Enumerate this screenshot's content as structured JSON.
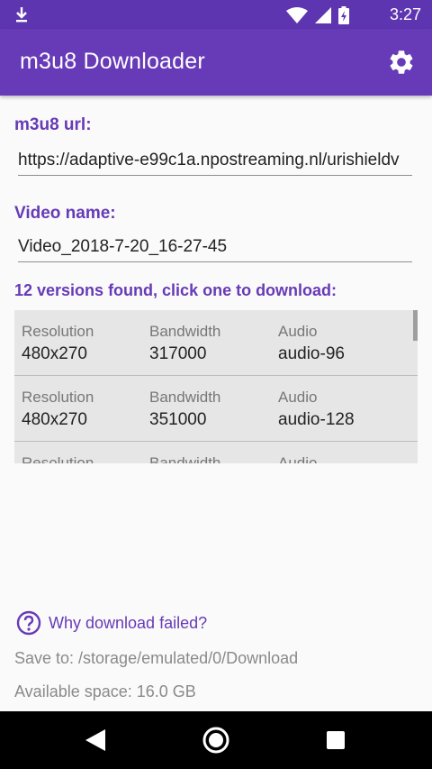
{
  "status_bar": {
    "time": "3:27",
    "icons": [
      "download-icon",
      "wifi-icon",
      "signal-icon",
      "battery-icon"
    ]
  },
  "app_bar": {
    "title": "m3u8 Downloader",
    "settings_icon": "gear-icon"
  },
  "form": {
    "url_label": "m3u8 url:",
    "url_value": "https://adaptive-e99c1a.npostreaming.nl/urishieldv",
    "name_label": "Video name:",
    "name_value": "Video_2018-7-20_16-27-45"
  },
  "versions": {
    "header": "12 versions found, click one to download:",
    "columns": [
      "Resolution",
      "Bandwidth",
      "Audio"
    ],
    "rows": [
      {
        "resolution": "480x270",
        "bandwidth": "317000",
        "audio": "audio-96"
      },
      {
        "resolution": "480x270",
        "bandwidth": "351000",
        "audio": "audio-128"
      }
    ]
  },
  "footer": {
    "help_link": "Why download failed?",
    "save_to": "Save to: /storage/emulated/0/Download",
    "available_space": "Available space: 16.0 GB"
  },
  "colors": {
    "primary": "#673ab7",
    "primary_dark": "#5e35b1"
  }
}
